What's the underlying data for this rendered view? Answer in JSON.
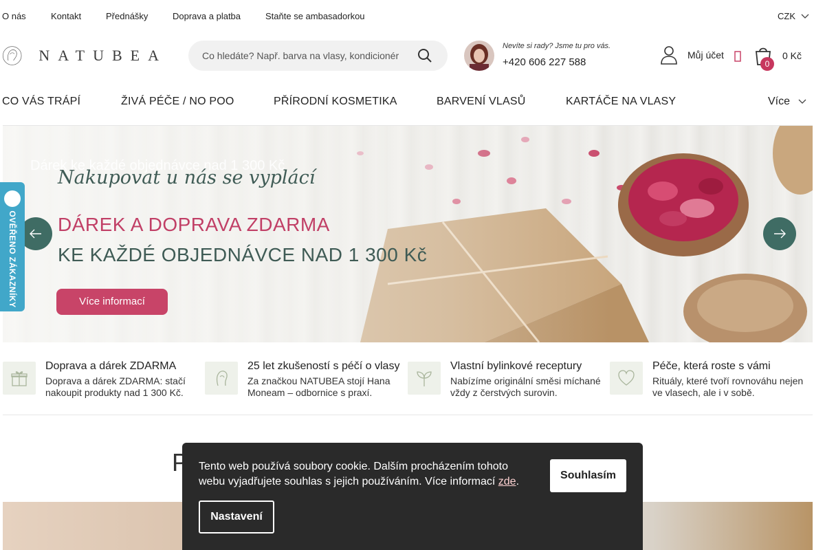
{
  "topbar": {
    "links": [
      "O nás",
      "Kontakt",
      "Přednášky",
      "Doprava a platba",
      "Staňte se ambasadorkou"
    ],
    "currency": "CZK"
  },
  "header": {
    "logo_text": "NATUBEA",
    "search_placeholder": "Co hledáte? Např. barva na vlasy, kondicionér",
    "help_text": "Nevíte si rady? Jsme tu pro vás.",
    "phone": "+420 606 227 588",
    "account_label": "Můj účet",
    "cart_count": "0",
    "cart_total": "0 Kč"
  },
  "nav": {
    "items": [
      "CO VÁS TRÁPÍ",
      "ŽIVÁ PÉČE / NO POO",
      "PŘÍRODNÍ KOSMETIKA",
      "BARVENÍ VLASŮ",
      "KARTÁČE NA VLASY"
    ],
    "more": "Více"
  },
  "hero": {
    "ghost_caption": "Dárek ke každé objednávce nad 1 300 Kč",
    "script": "Nakupovat u nás se vyplácí",
    "headline1": "DÁREK A DOPRAVA ZDARMA",
    "headline2": "KE KAŽDÉ OBJEDNÁVCE NAD 1 300 Kč",
    "button": "Více informací"
  },
  "verified_badge": "OVĚŘENO ZÁKAZNÍKY",
  "features": [
    {
      "icon": "gift-icon",
      "title": "Doprava a dárek ZDARMA",
      "desc": "Doprava a dárek ZDARMA: stačí nakoupit produkty nad 1 300 Kč."
    },
    {
      "icon": "woman-profile-icon",
      "title": "25 let zkušeností s péčí o vlasy",
      "desc": "Za značkou NATUBEA stojí Hana Moneam – odbornice s praxí."
    },
    {
      "icon": "sprout-icon",
      "title": "Vlastní bylinkové receptury",
      "desc": "Nabízíme originální směsi míchané vždy z čerstvých surovin."
    },
    {
      "icon": "heart-icon",
      "title": "Péče, která roste s vámi",
      "desc": "Rituály, které tvoří rovnováhu nejen ve vlasech, ale i v sobě."
    }
  ],
  "section_title_partial": "P",
  "cookie": {
    "text": "Tento web používá soubory cookie. Dalším procházením tohoto webu vyjadřujete souhlas s jejich používáním. Více informací ",
    "link": "zde",
    "accept": "Souhlasím",
    "settings": "Nastavení"
  },
  "colors": {
    "accent_pink": "#c84468",
    "accent_green": "#3f6c64",
    "verified_blue": "#41a7c9",
    "cookie_bg": "#2a2a2a"
  }
}
